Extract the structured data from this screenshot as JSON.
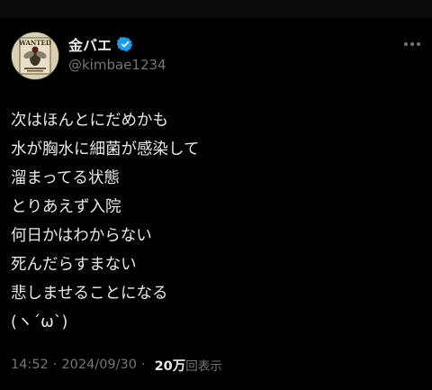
{
  "author": {
    "display_name": "金バエ",
    "handle": "@kimbae1234",
    "verified": true,
    "avatar_text": "WANTED"
  },
  "tweet": {
    "lines": [
      "次はほんとにだめかも",
      "水が胸水に細菌が感染して",
      "溜まってる状態",
      "とりあえず入院",
      "何日かはわからない",
      "死んだらすまない",
      "悲しませることになる",
      "(ヽ´ω`)"
    ]
  },
  "meta": {
    "time": "14:52",
    "separator": "·",
    "date": "2024/09/30",
    "views_count": "20万",
    "views_label": "回表示"
  },
  "colors": {
    "background": "#000000",
    "text": "#e7e9ea",
    "secondary_text": "#71767b",
    "verified_badge": "#1d9bf0"
  },
  "icons": {
    "verified": "verified-badge-icon",
    "more": "more-options-icon"
  }
}
